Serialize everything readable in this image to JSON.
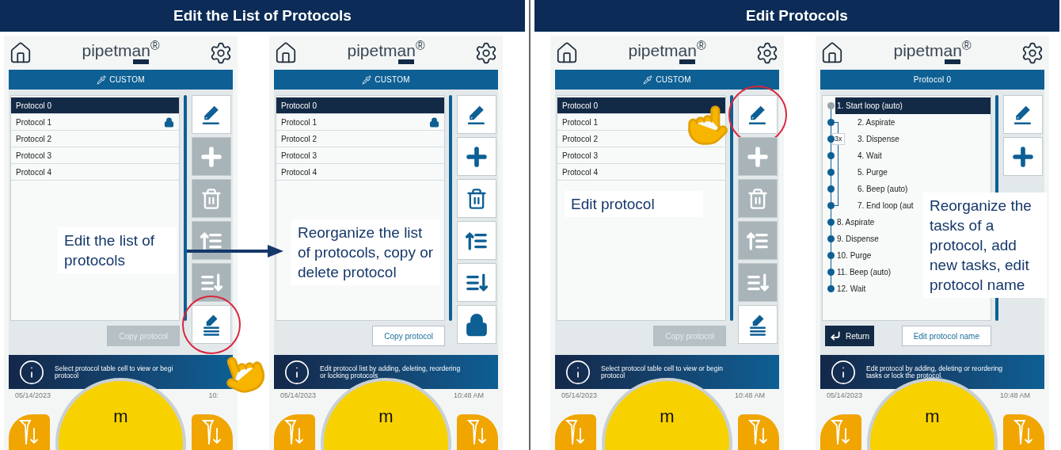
{
  "sections": [
    {
      "title": "Edit the List of Protocols",
      "arrow": true,
      "screens": [
        {
          "logo": "pipetman$^{®}$",
          "header": {
            "kind": "mode",
            "label": "CUSTOM"
          },
          "list": {
            "kind": "protocols",
            "items": [
              {
                "label": "Protocol 0",
                "selected": true,
                "locked": false
              },
              {
                "label": "Protocol 1",
                "selected": false,
                "locked": true
              },
              {
                "label": "Protocol 2",
                "selected": false,
                "locked": false
              },
              {
                "label": "Protocol 3",
                "selected": false,
                "locked": false
              },
              {
                "label": "Protocol 4",
                "selected": false,
                "locked": false
              }
            ]
          },
          "side_buttons": [
            {
              "kind": "edit",
              "disabled": false,
              "highlighted": false
            },
            {
              "kind": "add",
              "disabled": true,
              "highlighted": false
            },
            {
              "kind": "delete",
              "disabled": true,
              "highlighted": false
            },
            {
              "kind": "move_up",
              "disabled": true,
              "highlighted": false
            },
            {
              "kind": "move_down",
              "disabled": true,
              "highlighted": false
            },
            {
              "kind": "edit_list",
              "disabled": false,
              "highlighted": true
            }
          ],
          "bottom_buttons": [
            {
              "kind": "text",
              "label": "Copy protocol",
              "disabled": true
            }
          ],
          "info": [
            "Select protocol table cell to view or begi",
            "protocol"
          ],
          "date": "05/14/2023",
          "time": "10:",
          "hand": true,
          "main_button": "m",
          "callout": "Edit the list of protocols"
        },
        {
          "logo": "pipetman$^{®}$",
          "header": {
            "kind": "mode",
            "label": "CUSTOM"
          },
          "list": {
            "kind": "protocols",
            "items": [
              {
                "label": "Protocol 0",
                "selected": true,
                "locked": false
              },
              {
                "label": "Protocol 1",
                "selected": false,
                "locked": true
              },
              {
                "label": "Protocol 2",
                "selected": false,
                "locked": false
              },
              {
                "label": "Protocol 3",
                "selected": false,
                "locked": false
              },
              {
                "label": "Protocol 4",
                "selected": false,
                "locked": false
              }
            ]
          },
          "side_buttons": [
            {
              "kind": "edit",
              "disabled": false,
              "highlighted": false
            },
            {
              "kind": "add",
              "disabled": false,
              "highlighted": false
            },
            {
              "kind": "delete",
              "disabled": false,
              "highlighted": false
            },
            {
              "kind": "move_up",
              "disabled": false,
              "highlighted": false
            },
            {
              "kind": "move_down",
              "disabled": false,
              "highlighted": false
            },
            {
              "kind": "lock",
              "disabled": false,
              "highlighted": false
            }
          ],
          "bottom_buttons": [
            {
              "kind": "text",
              "label": "Copy protocol",
              "disabled": false
            }
          ],
          "info": [
            "Edit protocol list by adding, deleting, reordering",
            "or locking protocols"
          ],
          "date": "05/14/2023",
          "time": "10:48 AM",
          "hand": false,
          "main_button": "m",
          "callout": "Reorganize the list of protocols, copy or delete protocol"
        }
      ]
    },
    {
      "title": "Edit Protocols",
      "arrow": false,
      "screens": [
        {
          "logo": "pipetman$^{®}$",
          "header": {
            "kind": "mode",
            "label": "CUSTOM"
          },
          "list": {
            "kind": "protocols",
            "items": [
              {
                "label": "Protocol 0",
                "selected": true,
                "locked": false
              },
              {
                "label": "Protocol 1",
                "selected": false,
                "locked": false
              },
              {
                "label": "Protocol 2",
                "selected": false,
                "locked": false
              },
              {
                "label": "Protocol 3",
                "selected": false,
                "locked": false
              },
              {
                "label": "Protocol 4",
                "selected": false,
                "locked": false
              }
            ]
          },
          "side_buttons": [
            {
              "kind": "edit",
              "disabled": false,
              "highlighted": true
            },
            {
              "kind": "add",
              "disabled": true,
              "highlighted": false
            },
            {
              "kind": "delete",
              "disabled": true,
              "highlighted": false
            },
            {
              "kind": "move_up",
              "disabled": true,
              "highlighted": false
            },
            {
              "kind": "move_down",
              "disabled": true,
              "highlighted": false
            },
            {
              "kind": "edit_list",
              "disabled": false,
              "highlighted": false
            }
          ],
          "bottom_buttons": [
            {
              "kind": "text",
              "label": "Copy protocol",
              "disabled": true
            }
          ],
          "info": [
            "Select protocol table cell to view or begin",
            "protocol"
          ],
          "date": "05/14/2023",
          "time": "10:48 AM",
          "hand": true,
          "main_button": "m",
          "callout": "Edit protocol"
        },
        {
          "logo": "pipetman$^{®}$",
          "header": {
            "kind": "title",
            "label": "Protocol 0"
          },
          "list": {
            "kind": "tasks",
            "items": [
              {
                "label": "1. Start loop (auto)",
                "selected": true,
                "loop_count": "3x",
                "children": [
                  {
                    "label": "2. Aspirate",
                    "selected": false
                  },
                  {
                    "label": "3. Dispense",
                    "selected": false
                  },
                  {
                    "label": "4. Wait",
                    "selected": false
                  },
                  {
                    "label": "5. Purge",
                    "selected": false
                  },
                  {
                    "label": "6. Beep (auto)",
                    "selected": false
                  },
                  {
                    "label": "7. End loop (aut",
                    "selected": false
                  }
                ]
              },
              {
                "label": "8. Aspirate",
                "selected": false
              },
              {
                "label": "9. Dispense",
                "selected": false
              },
              {
                "label": "10. Purge",
                "selected": false
              },
              {
                "label": "11. Beep (auto)",
                "selected": false
              },
              {
                "label": "12. Wait",
                "selected": false
              }
            ]
          },
          "side_buttons": [
            {
              "kind": "edit",
              "disabled": false,
              "highlighted": false
            },
            {
              "kind": "add",
              "disabled": false,
              "highlighted": false
            }
          ],
          "bottom_buttons": [
            {
              "kind": "return",
              "label": "Return",
              "disabled": false
            },
            {
              "kind": "text",
              "label": "Edit protocol name",
              "disabled": false
            }
          ],
          "info": [
            "Edit protocol by adding, deleting or reordering",
            "tasks or lock the protocol."
          ],
          "date": "05/14/2023",
          "time": "10:48 AM",
          "hand": false,
          "main_button": "m",
          "callout": "Reorganize the tasks of a protocol, add new tasks, edit protocol name"
        }
      ]
    }
  ]
}
